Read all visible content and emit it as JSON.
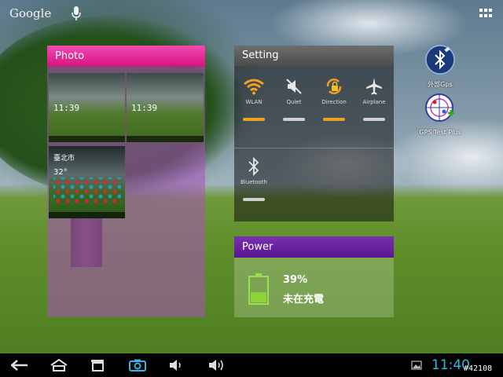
{
  "top_bar": {
    "search_label": "Google",
    "mic_icon": "mic-icon",
    "apps_icon": "apps-grid-icon"
  },
  "photo_widget": {
    "title": "Photo",
    "header_color": "#e0208f",
    "thumbnails": [
      {
        "clock": "11:39"
      },
      {
        "clock": "11:39"
      },
      {
        "city": "臺北市",
        "temp": "32°"
      }
    ]
  },
  "setting_widget": {
    "title": "Setting",
    "toggles": [
      {
        "label": "WLAN",
        "icon": "wifi-icon",
        "state": "on",
        "bar_color": "#f0a020"
      },
      {
        "label": "Quiet",
        "icon": "muted-speaker-icon",
        "state": "off",
        "bar_color": "#d0d0d0"
      },
      {
        "label": "Direction",
        "icon": "rotation-lock-icon",
        "state": "on",
        "bar_color": "#f0a020"
      },
      {
        "label": "Airplane",
        "icon": "airplane-icon",
        "state": "off",
        "bar_color": "#d0d0d0"
      },
      {
        "label": "Bluetooth",
        "icon": "bluetooth-icon",
        "state": "off",
        "bar_color": "#d0d0d0"
      }
    ]
  },
  "power_widget": {
    "title": "Power",
    "header_color": "#6a22a0",
    "percent": "39%",
    "level": 0.39,
    "status": "未在充電",
    "battery_color": "#8bd43a"
  },
  "shortcuts": [
    {
      "label": "外部Gps",
      "icon": "bluetooth-gps-icon"
    },
    {
      "label": "GPS Test Plus",
      "icon": "gps-test-icon"
    }
  ],
  "nav_bar": {
    "buttons": [
      {
        "name": "back-icon"
      },
      {
        "name": "home-icon"
      },
      {
        "name": "recent-apps-icon"
      },
      {
        "name": "camera-icon"
      },
      {
        "name": "volume-down-icon"
      },
      {
        "name": "volume-up-icon"
      }
    ],
    "gallery_icon": "gallery-icon",
    "clock": "11:40",
    "watermark_id": "#42108",
    "accent": "#34b5e5"
  }
}
